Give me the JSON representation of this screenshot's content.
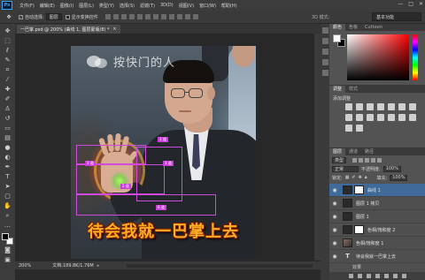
{
  "menubar": {
    "logo": "Ps",
    "items": [
      "文件(F)",
      "编辑(E)",
      "图像(I)",
      "图层(L)",
      "类型(Y)",
      "选择(S)",
      "滤镜(T)",
      "3D(D)",
      "视图(V)",
      "窗口(W)",
      "帮助(H)"
    ],
    "minimize": "—",
    "maximize": "□",
    "close": "✕"
  },
  "options": {
    "auto_select_label": "自动选择:",
    "auto_select_value": "图层",
    "show_transform_label": "显示变换控件",
    "mode_3d": "3D 模式:",
    "workspace": "基本功能"
  },
  "document": {
    "tab_title": "一巴掌.psd @ 200% (曲线 1, 图层蒙版/8) *",
    "tab_close": "×",
    "watermark": "按快门的人",
    "caption": "待会我就一巴掌上去",
    "guide_tags": [
      "1 道",
      "3 道",
      "3 道",
      "2 道",
      "6 道"
    ]
  },
  "status": {
    "zoom": "200%",
    "doc_size": "文档:189.8K/1.76M"
  },
  "panels": {
    "color_tabs": [
      "颜色",
      "色板",
      "Cutteen"
    ],
    "adj_tabs": [
      "调整",
      "样式"
    ],
    "adj_title": "添加调整",
    "layer_tabs": [
      "图层",
      "通道",
      "路径"
    ],
    "kind_filter": "类型",
    "blend_mode": "正常",
    "opacity_label": "不透明度:",
    "opacity_value": "100%",
    "lock_label": "锁定:",
    "fill_label": "填充:",
    "fill_value": "100%",
    "layers": [
      {
        "name": "曲线 1"
      },
      {
        "name": "图层 1 拷贝"
      },
      {
        "name": "图层 1"
      },
      {
        "name": "色相/饱和度 2"
      },
      {
        "name": "色相/饱和度 1"
      },
      {
        "name": "待会我就一巴掌上去"
      }
    ],
    "effects_label": "效果",
    "stroke_label": "描边"
  }
}
